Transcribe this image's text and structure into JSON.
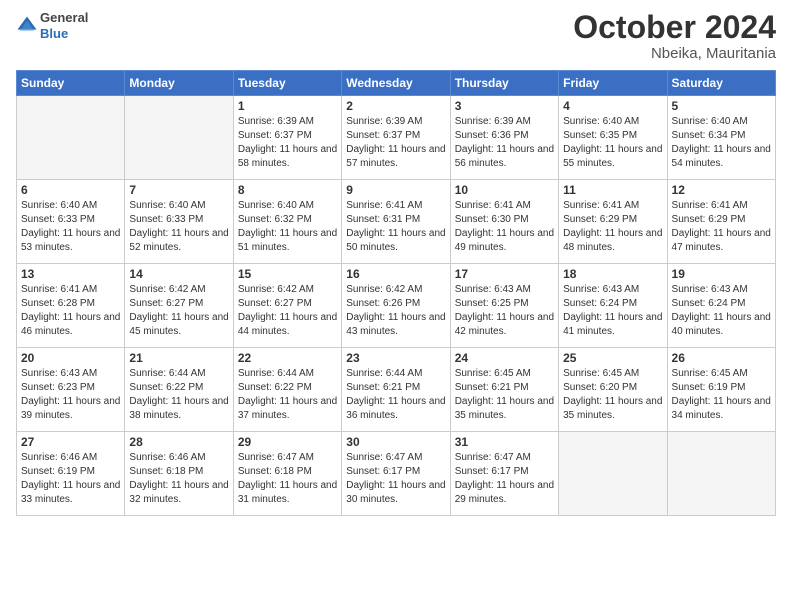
{
  "header": {
    "logo_general": "General",
    "logo_blue": "Blue",
    "month_title": "October 2024",
    "location": "Nbeika, Mauritania"
  },
  "days_of_week": [
    "Sunday",
    "Monday",
    "Tuesday",
    "Wednesday",
    "Thursday",
    "Friday",
    "Saturday"
  ],
  "weeks": [
    [
      {
        "day": "",
        "empty": true
      },
      {
        "day": "",
        "empty": true
      },
      {
        "day": "1",
        "sunrise": "Sunrise: 6:39 AM",
        "sunset": "Sunset: 6:37 PM",
        "daylight": "Daylight: 11 hours and 58 minutes."
      },
      {
        "day": "2",
        "sunrise": "Sunrise: 6:39 AM",
        "sunset": "Sunset: 6:37 PM",
        "daylight": "Daylight: 11 hours and 57 minutes."
      },
      {
        "day": "3",
        "sunrise": "Sunrise: 6:39 AM",
        "sunset": "Sunset: 6:36 PM",
        "daylight": "Daylight: 11 hours and 56 minutes."
      },
      {
        "day": "4",
        "sunrise": "Sunrise: 6:40 AM",
        "sunset": "Sunset: 6:35 PM",
        "daylight": "Daylight: 11 hours and 55 minutes."
      },
      {
        "day": "5",
        "sunrise": "Sunrise: 6:40 AM",
        "sunset": "Sunset: 6:34 PM",
        "daylight": "Daylight: 11 hours and 54 minutes."
      }
    ],
    [
      {
        "day": "6",
        "sunrise": "Sunrise: 6:40 AM",
        "sunset": "Sunset: 6:33 PM",
        "daylight": "Daylight: 11 hours and 53 minutes."
      },
      {
        "day": "7",
        "sunrise": "Sunrise: 6:40 AM",
        "sunset": "Sunset: 6:33 PM",
        "daylight": "Daylight: 11 hours and 52 minutes."
      },
      {
        "day": "8",
        "sunrise": "Sunrise: 6:40 AM",
        "sunset": "Sunset: 6:32 PM",
        "daylight": "Daylight: 11 hours and 51 minutes."
      },
      {
        "day": "9",
        "sunrise": "Sunrise: 6:41 AM",
        "sunset": "Sunset: 6:31 PM",
        "daylight": "Daylight: 11 hours and 50 minutes."
      },
      {
        "day": "10",
        "sunrise": "Sunrise: 6:41 AM",
        "sunset": "Sunset: 6:30 PM",
        "daylight": "Daylight: 11 hours and 49 minutes."
      },
      {
        "day": "11",
        "sunrise": "Sunrise: 6:41 AM",
        "sunset": "Sunset: 6:29 PM",
        "daylight": "Daylight: 11 hours and 48 minutes."
      },
      {
        "day": "12",
        "sunrise": "Sunrise: 6:41 AM",
        "sunset": "Sunset: 6:29 PM",
        "daylight": "Daylight: 11 hours and 47 minutes."
      }
    ],
    [
      {
        "day": "13",
        "sunrise": "Sunrise: 6:41 AM",
        "sunset": "Sunset: 6:28 PM",
        "daylight": "Daylight: 11 hours and 46 minutes."
      },
      {
        "day": "14",
        "sunrise": "Sunrise: 6:42 AM",
        "sunset": "Sunset: 6:27 PM",
        "daylight": "Daylight: 11 hours and 45 minutes."
      },
      {
        "day": "15",
        "sunrise": "Sunrise: 6:42 AM",
        "sunset": "Sunset: 6:27 PM",
        "daylight": "Daylight: 11 hours and 44 minutes."
      },
      {
        "day": "16",
        "sunrise": "Sunrise: 6:42 AM",
        "sunset": "Sunset: 6:26 PM",
        "daylight": "Daylight: 11 hours and 43 minutes."
      },
      {
        "day": "17",
        "sunrise": "Sunrise: 6:43 AM",
        "sunset": "Sunset: 6:25 PM",
        "daylight": "Daylight: 11 hours and 42 minutes."
      },
      {
        "day": "18",
        "sunrise": "Sunrise: 6:43 AM",
        "sunset": "Sunset: 6:24 PM",
        "daylight": "Daylight: 11 hours and 41 minutes."
      },
      {
        "day": "19",
        "sunrise": "Sunrise: 6:43 AM",
        "sunset": "Sunset: 6:24 PM",
        "daylight": "Daylight: 11 hours and 40 minutes."
      }
    ],
    [
      {
        "day": "20",
        "sunrise": "Sunrise: 6:43 AM",
        "sunset": "Sunset: 6:23 PM",
        "daylight": "Daylight: 11 hours and 39 minutes."
      },
      {
        "day": "21",
        "sunrise": "Sunrise: 6:44 AM",
        "sunset": "Sunset: 6:22 PM",
        "daylight": "Daylight: 11 hours and 38 minutes."
      },
      {
        "day": "22",
        "sunrise": "Sunrise: 6:44 AM",
        "sunset": "Sunset: 6:22 PM",
        "daylight": "Daylight: 11 hours and 37 minutes."
      },
      {
        "day": "23",
        "sunrise": "Sunrise: 6:44 AM",
        "sunset": "Sunset: 6:21 PM",
        "daylight": "Daylight: 11 hours and 36 minutes."
      },
      {
        "day": "24",
        "sunrise": "Sunrise: 6:45 AM",
        "sunset": "Sunset: 6:21 PM",
        "daylight": "Daylight: 11 hours and 35 minutes."
      },
      {
        "day": "25",
        "sunrise": "Sunrise: 6:45 AM",
        "sunset": "Sunset: 6:20 PM",
        "daylight": "Daylight: 11 hours and 35 minutes."
      },
      {
        "day": "26",
        "sunrise": "Sunrise: 6:45 AM",
        "sunset": "Sunset: 6:19 PM",
        "daylight": "Daylight: 11 hours and 34 minutes."
      }
    ],
    [
      {
        "day": "27",
        "sunrise": "Sunrise: 6:46 AM",
        "sunset": "Sunset: 6:19 PM",
        "daylight": "Daylight: 11 hours and 33 minutes."
      },
      {
        "day": "28",
        "sunrise": "Sunrise: 6:46 AM",
        "sunset": "Sunset: 6:18 PM",
        "daylight": "Daylight: 11 hours and 32 minutes."
      },
      {
        "day": "29",
        "sunrise": "Sunrise: 6:47 AM",
        "sunset": "Sunset: 6:18 PM",
        "daylight": "Daylight: 11 hours and 31 minutes."
      },
      {
        "day": "30",
        "sunrise": "Sunrise: 6:47 AM",
        "sunset": "Sunset: 6:17 PM",
        "daylight": "Daylight: 11 hours and 30 minutes."
      },
      {
        "day": "31",
        "sunrise": "Sunrise: 6:47 AM",
        "sunset": "Sunset: 6:17 PM",
        "daylight": "Daylight: 11 hours and 29 minutes."
      },
      {
        "day": "",
        "empty": true
      },
      {
        "day": "",
        "empty": true
      }
    ]
  ]
}
